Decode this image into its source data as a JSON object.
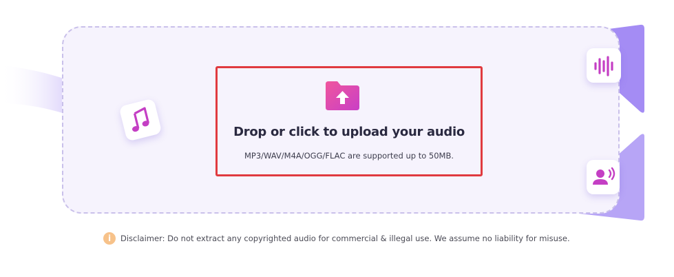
{
  "upload": {
    "title": "Drop or click to upload your audio",
    "subtitle": "MP3/WAV/M4A/OGG/FLAC are supported up to 50MB."
  },
  "disclaimer": {
    "icon": "info-icon",
    "text": "Disclaimer: Do not extract any copyrighted audio for commercial & illegal use. We assume no liability for misuse."
  },
  "icons": {
    "folder": "folder-upload-icon",
    "music": "music-note-icon",
    "wave": "audio-wave-icon",
    "voice": "voice-icon"
  },
  "colors": {
    "accent_pink": "#e8489a",
    "accent_purple": "#8d6cf0",
    "highlight_border": "#e03a3f",
    "info": "#f7c28a"
  }
}
